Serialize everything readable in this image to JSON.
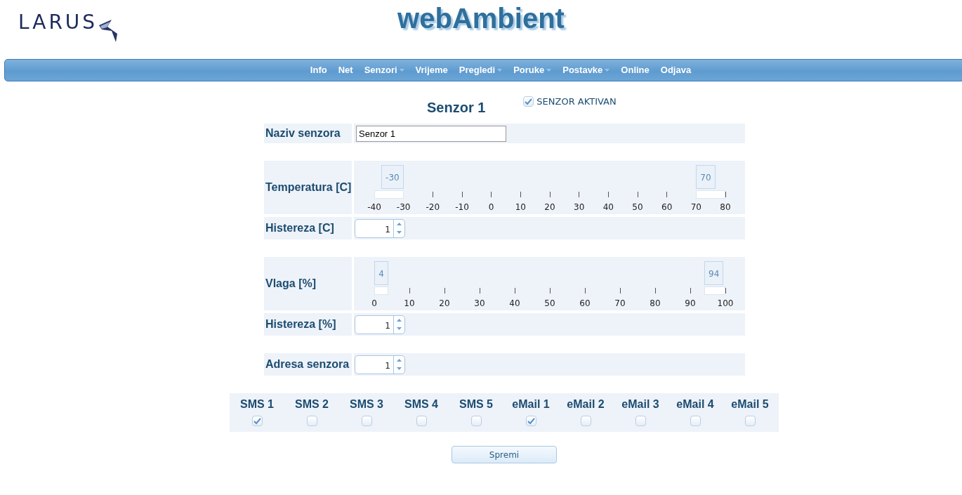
{
  "header": {
    "logo": "LARUS",
    "title": "webAmbient"
  },
  "nav": [
    {
      "label": "Info",
      "has_menu": false
    },
    {
      "label": "Net",
      "has_menu": false
    },
    {
      "label": "Senzori",
      "has_menu": true
    },
    {
      "label": "Vrijeme",
      "has_menu": false
    },
    {
      "label": "Pregledi",
      "has_menu": true
    },
    {
      "label": "Poruke",
      "has_menu": true
    },
    {
      "label": "Postavke",
      "has_menu": true
    },
    {
      "label": "Online",
      "has_menu": false
    },
    {
      "label": "Odjava",
      "has_menu": false
    }
  ],
  "sensor": {
    "title": "Senzor 1",
    "active": {
      "label": "SENZOR AKTIVAN",
      "checked": true
    }
  },
  "groups": [
    [
      {
        "kind": "text",
        "label": "Naziv senzora",
        "value": "Senzor 1"
      }
    ],
    [
      {
        "kind": "range",
        "label": "Temperatura [C]",
        "low": {
          "level": 0.0833,
          "reading": "-30"
        },
        "high": {
          "level": 0.9167,
          "reading": "70"
        },
        "ticks": [
          "-40",
          "-30",
          "-20",
          "-10",
          "0",
          "10",
          "20",
          "30",
          "40",
          "50",
          "60",
          "70",
          "80"
        ]
      },
      {
        "kind": "spinner",
        "label": "Histereza [C]",
        "value": "1"
      }
    ],
    [
      {
        "kind": "range",
        "label": "Vlaga [%]",
        "low": {
          "level": 0.04,
          "reading": "4"
        },
        "high": {
          "level": 0.94,
          "reading": "94"
        },
        "ticks": [
          "0",
          "10",
          "20",
          "30",
          "40",
          "50",
          "60",
          "70",
          "80",
          "90",
          "100"
        ]
      },
      {
        "kind": "spinner",
        "label": "Histereza [%]",
        "value": "1"
      }
    ],
    [
      {
        "kind": "spinner",
        "label": "Adresa senzora",
        "value": "1"
      }
    ]
  ],
  "notifications": [
    {
      "label": "SMS 1",
      "checked": true
    },
    {
      "label": "SMS 2",
      "checked": false
    },
    {
      "label": "SMS 3",
      "checked": false
    },
    {
      "label": "SMS 4",
      "checked": false
    },
    {
      "label": "SMS 5",
      "checked": false
    },
    {
      "label": "eMail 1",
      "checked": true
    },
    {
      "label": "eMail 2",
      "checked": false
    },
    {
      "label": "eMail 3",
      "checked": false
    },
    {
      "label": "eMail 4",
      "checked": false
    },
    {
      "label": "eMail 5",
      "checked": false
    }
  ],
  "save_button": "Spremi"
}
